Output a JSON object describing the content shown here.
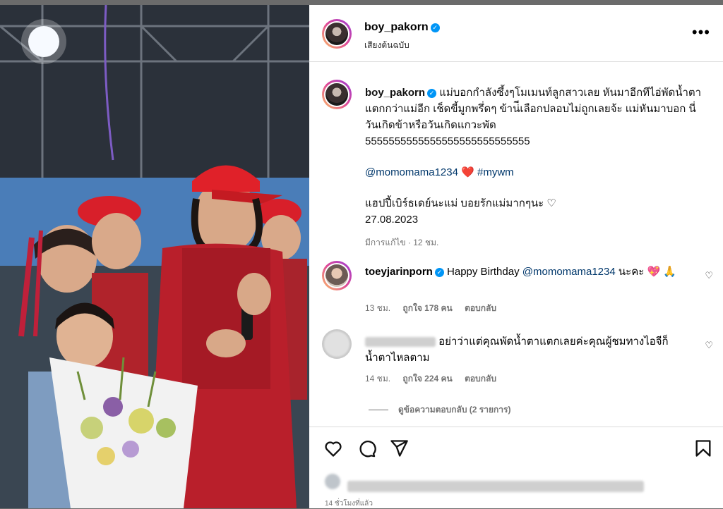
{
  "post": {
    "author": "boy_pakorn",
    "audio": "เสียงต้นฉบับ",
    "caption_line1": "แม่บอกกำลังซึ้งๆโมเมนท์ลูกสาวเลย หันมาอีกทีไอ่พัดน้ำตาแตกกว่าแม่อีก เช็ดขี้มูกพรึ่ดๆ ข้าน่ีเลือกปลอบไม่ถูกเลยจ้ะ แม่หันมาบอก นี่วันเกิดข้าหรือวันเกิดแกวะพัด",
    "caption_laugh": "5555555555555555555555555555",
    "mention": "@momomama1234",
    "hashtag": "#mywm",
    "birthday_line": "แฮปปี้เบิร์ธเดย์นะแม่ บอยรักแม่มากๆนะ ♡",
    "date": "27.08.2023",
    "edited": "มีการแก้ไข · 12 ชม.",
    "time_ago": "14 ชั่วโมงที่แล้ว"
  },
  "comments": [
    {
      "user": "toeyjarinporn",
      "text_pre": "Happy Birthday",
      "mention": "@momomama1234",
      "text_post": "นะคะ 💖 🙏",
      "age": "13 ชม.",
      "likes": "ถูกใจ 178 คน",
      "reply": "ตอบกลับ"
    },
    {
      "user": "",
      "text": "อย่าว่าแต่คุณพัดน้ำตาแตกเลยค่ะคุณผู้ชมทางไอจีก็น้ำตาไหลตาม",
      "age": "14 ชม.",
      "likes": "ถูกใจ 224 คน",
      "reply": "ตอบกลับ"
    }
  ],
  "view_replies": "ดูข้อความตอบกลับ (2 รายการ)",
  "icons": [
    "more-options-icon",
    "heart-icon",
    "comment-icon",
    "share-icon",
    "bookmark-icon",
    "verified-badge-icon"
  ],
  "colors": {
    "link": "#00376b",
    "verified": "#0095f6",
    "heart": "#e0245e",
    "cap": "#d11a2a"
  }
}
